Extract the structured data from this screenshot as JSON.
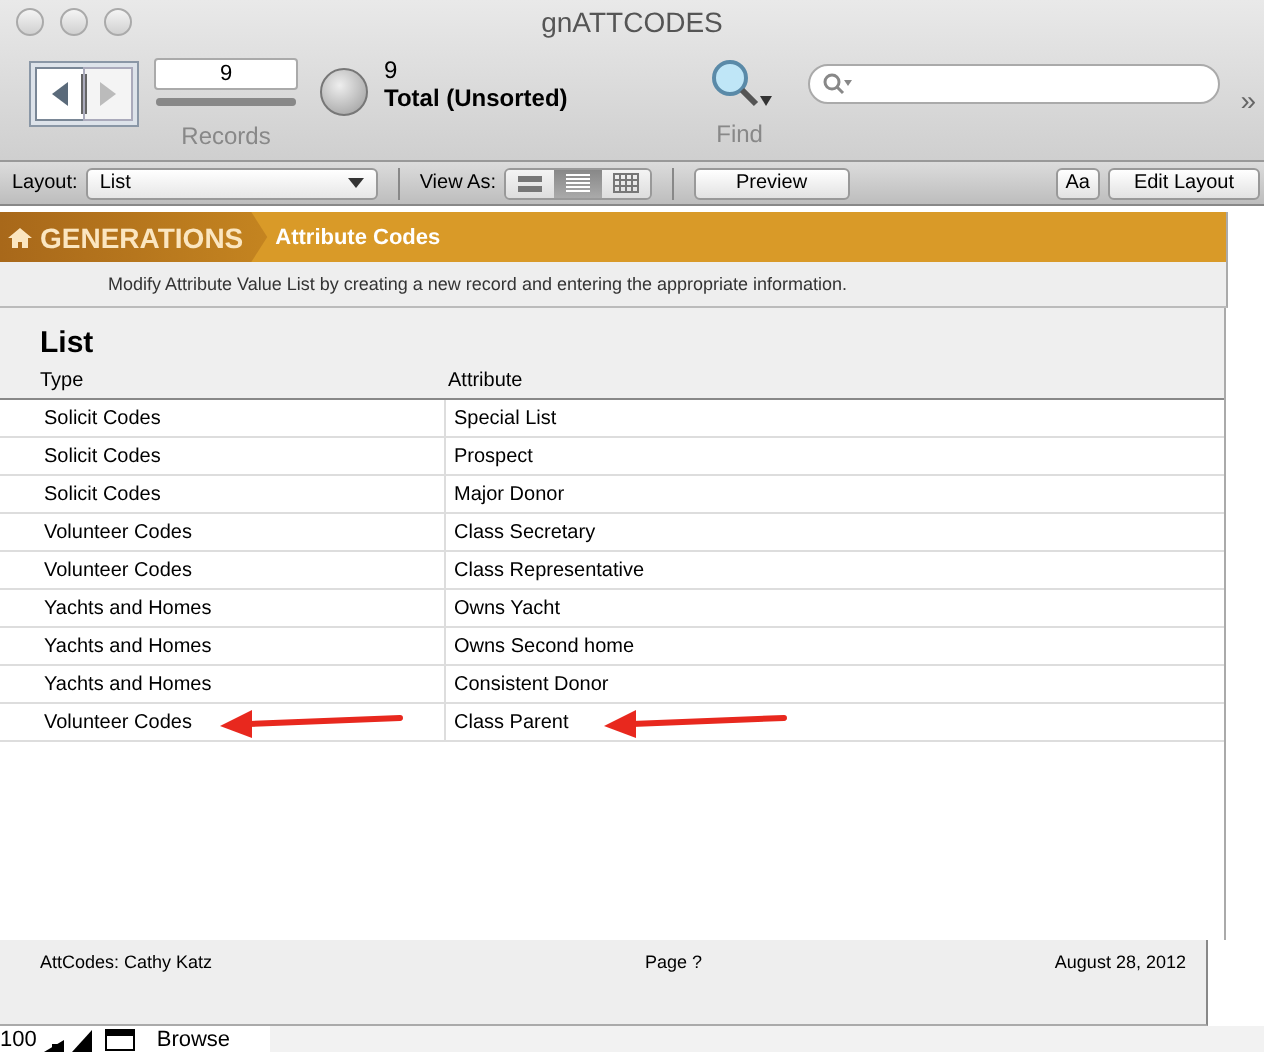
{
  "window": {
    "title": "gnATTCODES"
  },
  "toolbar": {
    "record_number": "9",
    "record_slider": {
      "level": 1
    },
    "record_count": "9",
    "sort_status": "Total (Unsorted)",
    "records_label": "Records",
    "find_label": "Find",
    "overflow": "»"
  },
  "layout_bar": {
    "layout_label": "Layout:",
    "layout_value": "List",
    "view_as_label": "View As:",
    "view_modes": [
      {
        "kind": "form",
        "selected": false
      },
      {
        "kind": "list",
        "selected": true
      },
      {
        "kind": "table",
        "selected": false
      }
    ],
    "preview_button": "Preview",
    "text_button": "Aa",
    "edit_layout_button": "Edit Layout"
  },
  "header": {
    "brand": "GENERATIONS",
    "section": "Attribute Codes",
    "instructions": "Modify Attribute Value List by creating a new record and entering the appropriate information."
  },
  "list": {
    "title": "List",
    "columns": [
      "Type",
      "Attribute"
    ],
    "rows": [
      {
        "type": "Solicit Codes",
        "attribute": "Special List",
        "arrows": false
      },
      {
        "type": "Solicit Codes",
        "attribute": "Prospect",
        "arrows": false
      },
      {
        "type": "Solicit Codes",
        "attribute": "Major Donor",
        "arrows": false
      },
      {
        "type": "Volunteer Codes",
        "attribute": "Class Secretary",
        "arrows": false
      },
      {
        "type": "Volunteer Codes",
        "attribute": "Class Representative",
        "arrows": false
      },
      {
        "type": "Yachts and Homes",
        "attribute": "Owns Yacht",
        "arrows": false
      },
      {
        "type": "Yachts and Homes",
        "attribute": "Owns Second home",
        "arrows": false
      },
      {
        "type": "Yachts and Homes",
        "attribute": "Consistent Donor",
        "arrows": false
      },
      {
        "type": "Volunteer Codes",
        "attribute": "Class Parent",
        "arrows": true
      }
    ]
  },
  "footer": {
    "left": "AttCodes: Cathy Katz",
    "center": "Page ?",
    "right": "August 28, 2012"
  },
  "status_bar": {
    "zoom": "100",
    "mode": "Browse"
  }
}
